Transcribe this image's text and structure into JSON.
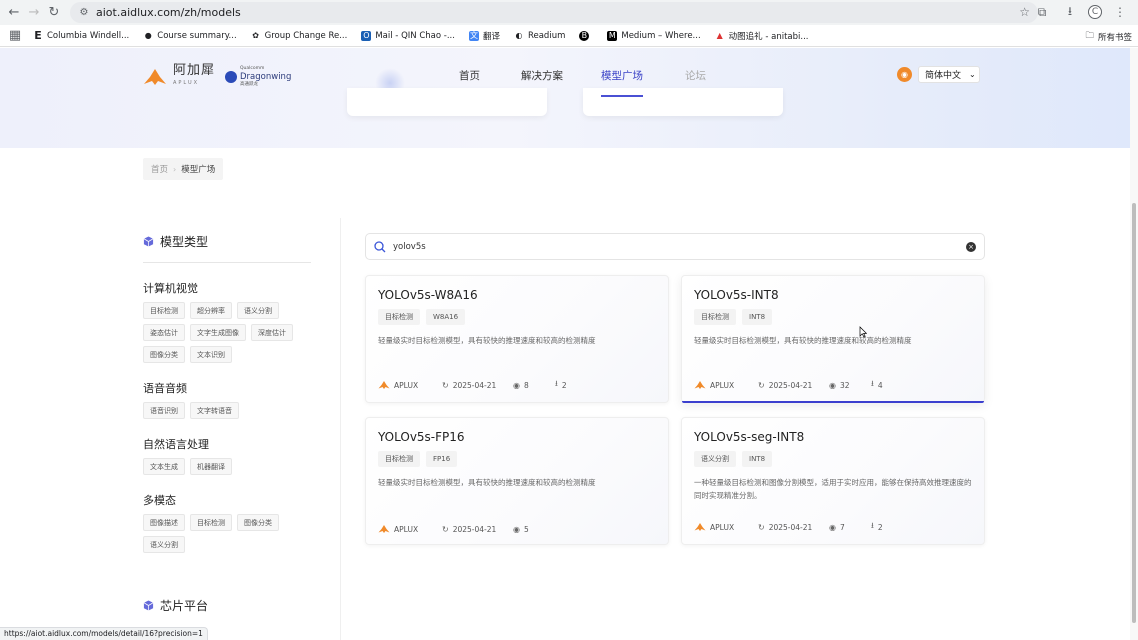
{
  "browser": {
    "url": "aiot.aidlux.com/zh/models",
    "bookmarks": [
      {
        "icon": "E",
        "label": "Columbia Windell..."
      },
      {
        "icon": "●",
        "label": "Course summary..."
      },
      {
        "icon": "✿",
        "label": "Group Change Re..."
      },
      {
        "icon": "O",
        "label": "Mail - QIN Chao -..."
      },
      {
        "icon": "文",
        "label": "翻译"
      },
      {
        "icon": "◐",
        "label": "Readium"
      },
      {
        "icon": "B",
        "label": ""
      },
      {
        "icon": "M",
        "label": "Medium – Where..."
      },
      {
        "icon": "▲",
        "label": "动图追礼 - anitabi..."
      }
    ],
    "bookmarks_folder": "所有书签",
    "profile_initial": "C",
    "status_url": "https://aiot.aidlux.com/models/detail/16?precision=1"
  },
  "header": {
    "logo_name": "阿加犀",
    "logo_sub": "APLUX",
    "partner_top": "Dragonwing",
    "partner_small": "Qualcomm",
    "partner_cn": "高通跃龙",
    "nav": [
      "首页",
      "解决方案",
      "模型广场",
      "论坛"
    ],
    "active_nav": "模型广场",
    "language": "简体中文"
  },
  "breadcrumb": {
    "home": "首页",
    "current": "模型广场"
  },
  "sidebar": {
    "section_title": "模型类型",
    "groups": [
      {
        "title": "计算机视觉",
        "tags": [
          "目标检测",
          "超分辨率",
          "语义分割",
          "姿态估计",
          "文字生成图像",
          "深度估计",
          "图像分类",
          "文本识别"
        ]
      },
      {
        "title": "语音音频",
        "tags": [
          "语音识别",
          "文字转语音"
        ]
      },
      {
        "title": "自然语言处理",
        "tags": [
          "文本生成",
          "机器翻译"
        ]
      },
      {
        "title": "多模态",
        "tags": [
          "图像描述",
          "目标检测",
          "图像分类",
          "语义分割"
        ]
      }
    ],
    "chip_section_title": "芯片平台"
  },
  "search": {
    "value": "yolov5s",
    "placeholder": ""
  },
  "cards": [
    {
      "title": "YOLOv5s-W8A16",
      "tags": [
        "目标检测",
        "W8A16"
      ],
      "desc": "轻量级实时目标检测模型，具有较快的推理速度和较高的检测精度",
      "org": "APLUX",
      "date": "2025-04-21",
      "views": "8",
      "downloads": "2"
    },
    {
      "title": "YOLOv5s-INT8",
      "tags": [
        "目标检测",
        "INT8"
      ],
      "desc": "轻量级实时目标检测模型，具有较快的推理速度和较高的检测精度",
      "org": "APLUX",
      "date": "2025-04-21",
      "views": "32",
      "downloads": "4"
    },
    {
      "title": "YOLOv5s-FP16",
      "tags": [
        "目标检测",
        "FP16"
      ],
      "desc": "轻量级实时目标检测模型，具有较快的推理速度和较高的检测精度",
      "org": "APLUX",
      "date": "2025-04-21",
      "views": "5",
      "downloads": ""
    },
    {
      "title": "YOLOv5s-seg-INT8",
      "tags": [
        "语义分割",
        "INT8"
      ],
      "desc": "一种轻量级目标检测和图像分割模型，适用于实时应用，能够在保持高效推理速度的同时实现精准分割。",
      "org": "APLUX",
      "date": "2025-04-21",
      "views": "7",
      "downloads": "2"
    }
  ]
}
